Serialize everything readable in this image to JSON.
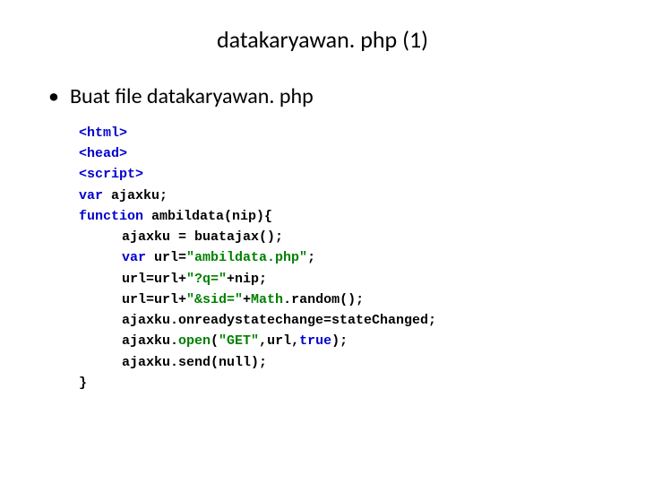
{
  "title": "datakaryawan. php (1)",
  "bullet": "Buat file datakaryawan. php",
  "code": {
    "l1_tag": "<html>",
    "l2_tag": "<head>",
    "l3_tag": "<script>",
    "l4_var": "var",
    "l4_rest": " ajaxku;",
    "l5_fn": "function",
    "l5_rest": " ambildata(nip){",
    "l6": "ajaxku = buatajax();",
    "l7_var": "var",
    "l7_mid": " url=",
    "l7_str": "\"ambildata.php\"",
    "l7_end": ";",
    "l8_a": "url=url+",
    "l8_str": "\"?q=\"",
    "l8_b": "+nip;",
    "l9_a": "url=url+",
    "l9_str": "\"&sid=\"",
    "l9_b": "+",
    "l9_math": "Math",
    "l9_c": ".random();",
    "l10": "ajaxku.onreadystatechange=stateChanged;",
    "l11_a": "ajaxku.",
    "l11_open": "open",
    "l11_b": "(",
    "l11_str": "\"GET\"",
    "l11_c": ",url,",
    "l11_true": "true",
    "l11_d": ");",
    "l12": "ajaxku.send(null);",
    "l13": "}"
  }
}
